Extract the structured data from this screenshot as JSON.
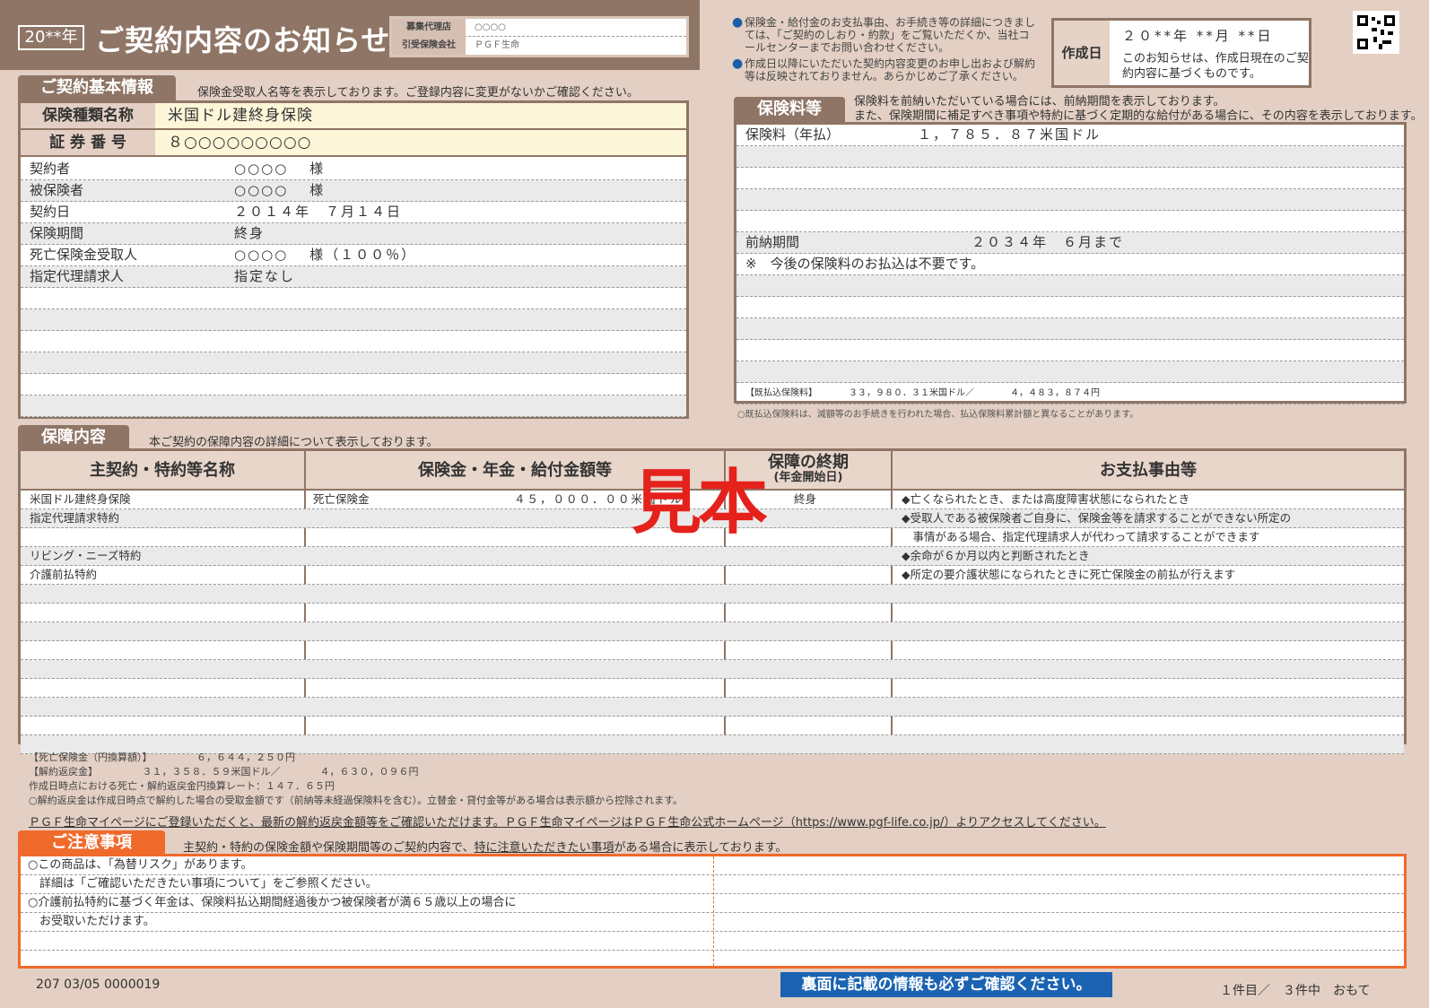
{
  "header": {
    "year_badge": "20**年",
    "title": "ご契約内容のお知らせ",
    "agent_label": "募集代理店",
    "agent_value": "○○○○",
    "insurer_label": "引受保険会社",
    "insurer_value": "ＰＧＦ生命",
    "notice_1": "保険金・給付金のお支払事由、お手続き等の詳細につきましては、「ご契約のしおり・約款」をご覧いただくか、当社コールセンターまでお問い合わせください。",
    "notice_2": "作成日以降にいただいた契約内容変更のお申し出および解約等は反映されておりません。あらかじめご了承ください。",
    "created_label": "作成日",
    "created_date": "２０**年 **月 **日",
    "created_note": "このお知らせは、作成日現在のご契約内容に基づくものです。"
  },
  "basic": {
    "tab": "ご契約基本情報",
    "desc": "保険金受取人名等を表示しております。ご登録内容に変更がないかご確認ください。",
    "product_label": "保険種類名称",
    "product_value": "米国ドル建終身保険",
    "policy_label": "証 券 番 号",
    "policy_value": "８○○○○○○○○○",
    "rows": [
      {
        "label": "契約者",
        "value": "○○○○　 様"
      },
      {
        "label": "被保険者",
        "value": "○○○○　 様"
      },
      {
        "label": "契約日",
        "value": "２０１４年　７月１４日"
      },
      {
        "label": "保険期間",
        "value": "終身"
      },
      {
        "label": "死亡保険金受取人",
        "value": "○○○○　 様（１００％）"
      },
      {
        "label": "指定代理請求人",
        "value": "指定なし"
      }
    ]
  },
  "premium": {
    "tab": "保険料等",
    "desc_1": "保険料を前納いただいている場合には、前納期間を表示しております。",
    "desc_2": "また、保険期間に補足すべき事項や特約に基づく定期的な給付がある場合に、その内容を表示しております。",
    "premium_label": "保険料（年払）",
    "premium_value": "１，７８５．８７米国ドル",
    "prepay_label": "前納期間",
    "prepay_value": "２０３４年　６月まで",
    "prepay_note": "※　今後の保険料のお払込は不要です。",
    "paid_line": "【既払込保険料】　　　　３３，９８０．３１米国ドル／　　　　４，４８３，８７４円",
    "footnote": "○既払込保険料は、減額等のお手続きを行われた場合、払込保険料累計額と異なることがあります。"
  },
  "coverage": {
    "tab": "保障内容",
    "desc": "本ご契約の保障内容の詳細について表示しております。",
    "col_1": "主契約・特約等名称",
    "col_2": "保険金・年金・給付金額等",
    "col_3": "保障の終期",
    "col_3_sub": "(年金開始日)",
    "col_4": "お支払事由等",
    "rows": [
      {
        "name": "米国ドル建終身保険",
        "amount_label": "死亡保険金",
        "amount": "４５，０００．００米国ドル",
        "term": "終身",
        "reason": "◆亡くなられたとき、または高度障害状態になられたとき"
      },
      {
        "name": "指定代理請求特約",
        "amount_label": "",
        "amount": "",
        "term": "",
        "reason": "◆受取人である被保険者ご自身に、保険金等を請求することができない所定の"
      },
      {
        "name": "",
        "amount_label": "",
        "amount": "",
        "term": "",
        "reason": "　事情がある場合、指定代理請求人が代わって請求することができます"
      },
      {
        "name": "リビング・ニーズ特約",
        "amount_label": "",
        "amount": "",
        "term": "",
        "reason": "◆余命が６か月以内と判断されたとき"
      },
      {
        "name": "介護前払特約",
        "amount_label": "",
        "amount": "",
        "term": "",
        "reason": "◆所定の要介護状態になられたときに死亡保険金の前払が行えます"
      }
    ],
    "sample_stamp": "見本",
    "note_1": "【死亡保険金（円換算額）】　　　　　６，６４４，２５０円",
    "note_2": "【解約返戻金】　　　　　３１，３５８．５９米国ドル／　　　　４，６３０，０９６円",
    "note_3": "作成日時点における死亡・解約返戻金円換算レート：１４７．６５円",
    "note_4": "○解約返戻金は作成日時点で解約した場合の受取金額です（前納等未経過保険料を含む）。立替金・貸付金等がある場合は表示額から控除されます。",
    "mypage": "ＰＧＦ生命マイページにご登録いただくと、最新の解約返戻金額等をご確認いただけます。ＰＧＦ生命マイページはＰＧＦ生命公式ホームページ（https://www.pgf-life.co.jp/）よりアクセスしてください。"
  },
  "caution": {
    "tab": "ご注意事項",
    "desc_a": "主契約・特約の保険金額や保険期間等のご契約内容で、",
    "desc_b": "特に注意いただきたい事項",
    "desc_c": "がある場合に表示しております。",
    "lines": [
      "○この商品は、「為替リスク」があります。",
      "　詳細は「ご確認いただきたい事項について」をご参照ください。",
      "○介護前払特約に基づく年金は、保険料払込期間経過後かつ被保険者が満６５歳以上の場合に",
      "　お受取いただけます。"
    ]
  },
  "footer": {
    "code": "207 03/05 0000019",
    "banner": "裏面に記載の情報も必ずご確認ください。",
    "page": "１件目／　３件中　おもて"
  },
  "colors": {
    "brown": "#8f7566",
    "beige": "#e3cfc3",
    "orange": "#f06a2c",
    "red": "#e5211c",
    "blue": "#1b63b2"
  }
}
